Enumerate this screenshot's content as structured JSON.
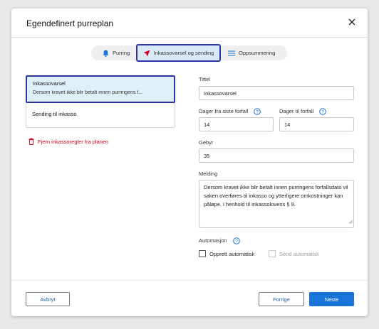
{
  "dialog": {
    "title": "Egendefinert purreplan"
  },
  "steps": [
    {
      "label": "Purring",
      "icon": "bell-icon"
    },
    {
      "label": "Inkassovarsel og sending",
      "icon": "send-icon",
      "active": true
    },
    {
      "label": "Oppsummering",
      "icon": "list-icon"
    }
  ],
  "rules": {
    "selected_title": "Inkassovarsel",
    "selected_desc": "Dersom kravet ikke blir betalt innen purringens f...",
    "second_title": "Sending til inkasso",
    "remove_label": "Fjern inkassoregler fra planen"
  },
  "form": {
    "title_label": "Tittel",
    "title_value": "Inkassovarsel",
    "days_last_label": "Dager fra siste forfall",
    "days_last_value": "14",
    "days_to_label": "Dager til forfall",
    "days_to_value": "14",
    "fee_label": "Gebyr",
    "fee_value": "35",
    "message_label": "Melding",
    "message_value": "Dersom kravet ikke blir betalt innen purringens forfallsdato vil saken overføres til inkasso og ytterligere omkostninger kan påløpe, i henhold til inkassolovens § 9.",
    "automation_label": "Automasjon",
    "auto_create_label": "Opprett automatisk",
    "auto_send_label": "Send automatisk"
  },
  "footer": {
    "cancel_label": "Avbryt",
    "previous_label": "Forrige",
    "next_label": "Neste"
  },
  "colors": {
    "accent": "#1a73d9",
    "highlight_border": "#2b35a8",
    "danger": "#d0021b"
  }
}
